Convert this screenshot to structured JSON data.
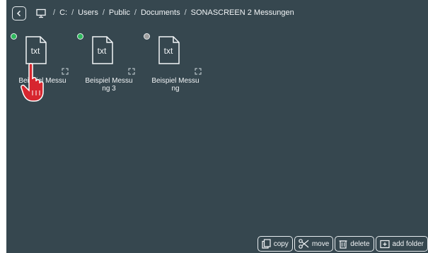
{
  "breadcrumb": {
    "parts": [
      "C:",
      "Users",
      "Public",
      "Documents",
      "SONASCREEN 2 Messungen"
    ]
  },
  "files": [
    {
      "label_line1": "Beispiel Messu",
      "label_line2": "",
      "status_color": "#2eb85c",
      "icon_text": "txt"
    },
    {
      "label_line1": "Beispiel Messu",
      "label_line2": "ng 3",
      "status_color": "#2eb85c",
      "icon_text": "txt"
    },
    {
      "label_line1": "Beispiel Messu",
      "label_line2": "ng",
      "status_color": "#9e9e9e",
      "icon_text": "txt"
    }
  ],
  "toolbar": {
    "copy_label": "copy",
    "move_label": "move",
    "delete_label": "delete",
    "add_folder_label": "add folder"
  },
  "colors": {
    "background": "#36474f",
    "foreground": "#f2f5f7",
    "cursor_red": "#d7262f"
  },
  "icons": [
    "back-icon",
    "computer-icon",
    "txt-file-icon",
    "expand-icon",
    "hand-pointer-icon",
    "copy-icon",
    "scissors-icon",
    "trash-icon",
    "add-folder-icon"
  ]
}
